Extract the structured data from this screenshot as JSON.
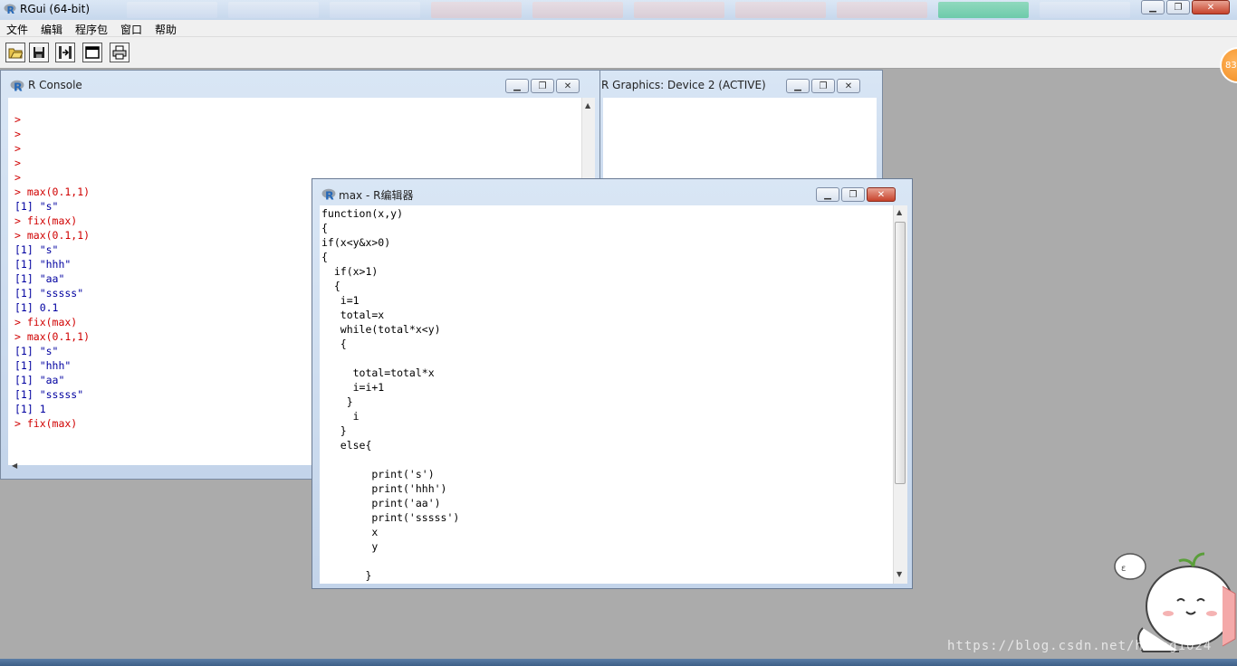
{
  "app": {
    "title": "RGui (64-bit)"
  },
  "menu": {
    "items": [
      "文件",
      "编辑",
      "程序包",
      "窗口",
      "帮助"
    ]
  },
  "toolbar": {
    "buttons": [
      "open-script",
      "save-workspace",
      "load-workspace",
      "new-window",
      "print"
    ]
  },
  "notification_badge": "83",
  "console": {
    "title": "R Console",
    "lines": [
      {
        "text": ">",
        "kind": "prompt"
      },
      {
        "text": ">",
        "kind": "prompt"
      },
      {
        "text": ">",
        "kind": "prompt"
      },
      {
        "text": ">",
        "kind": "prompt"
      },
      {
        "text": ">",
        "kind": "prompt"
      },
      {
        "text": "> max(0.1,1)",
        "kind": "prompt"
      },
      {
        "text": "[1] \"s\"",
        "kind": "out"
      },
      {
        "text": "> fix(max)",
        "kind": "prompt"
      },
      {
        "text": "> max(0.1,1)",
        "kind": "prompt"
      },
      {
        "text": "[1] \"s\"",
        "kind": "out"
      },
      {
        "text": "[1] \"hhh\"",
        "kind": "out"
      },
      {
        "text": "[1] \"aa\"",
        "kind": "out"
      },
      {
        "text": "[1] \"sssss\"",
        "kind": "out"
      },
      {
        "text": "[1] 0.1",
        "kind": "out"
      },
      {
        "text": "> fix(max)",
        "kind": "prompt"
      },
      {
        "text": "> max(0.1,1)",
        "kind": "prompt"
      },
      {
        "text": "[1] \"s\"",
        "kind": "out"
      },
      {
        "text": "[1] \"hhh\"",
        "kind": "out"
      },
      {
        "text": "[1] \"aa\"",
        "kind": "out"
      },
      {
        "text": "[1] \"sssss\"",
        "kind": "out"
      },
      {
        "text": "[1] 1",
        "kind": "out"
      },
      {
        "text": "> fix(max)",
        "kind": "prompt"
      }
    ]
  },
  "graphics": {
    "title": "R Graphics: Device 2 (ACTIVE)"
  },
  "editor": {
    "title": "max - R编辑器",
    "code": [
      "function(x,y)",
      "{",
      "if(x<y&x>0)",
      "{",
      "  if(x>1)",
      "  {",
      "   i=1",
      "   total=x",
      "   while(total*x<y)",
      "   {",
      "",
      "     total=total*x",
      "     i=i+1",
      "    }",
      "     i",
      "   }",
      "   else{",
      "",
      "        print('s')",
      "        print('hhh')",
      "        print('aa')",
      "        print('sssss')",
      "        x",
      "        y",
      "",
      "       }"
    ]
  },
  "watermark": "https://blog.csdn.net/huang1024"
}
